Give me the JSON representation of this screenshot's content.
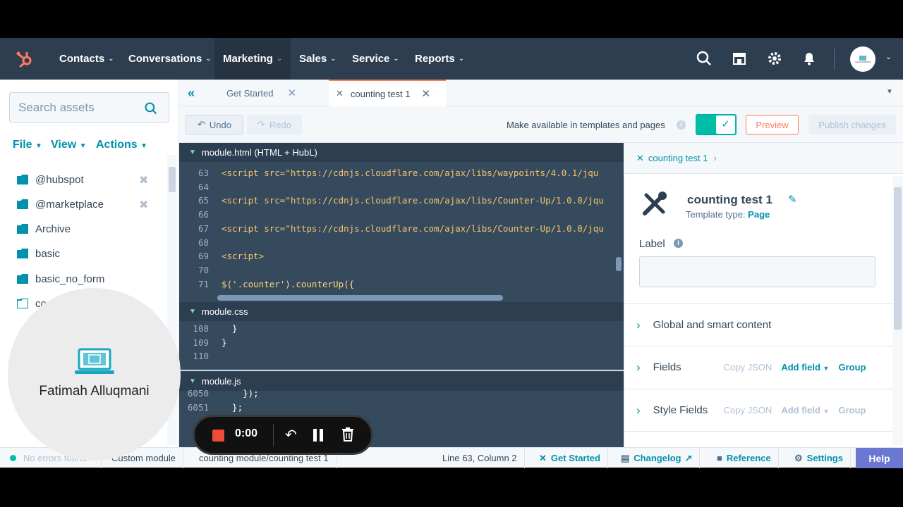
{
  "nav": {
    "items": [
      {
        "label": "Contacts"
      },
      {
        "label": "Conversations"
      },
      {
        "label": "Marketing"
      },
      {
        "label": "Sales"
      },
      {
        "label": "Service"
      },
      {
        "label": "Reports"
      }
    ],
    "avatar_text": "CHILD ANIMATE"
  },
  "sidebar": {
    "search_placeholder": "Search assets",
    "menus": [
      "File",
      "View",
      "Actions"
    ],
    "folders": [
      "@hubspot",
      "@marketplace",
      "Archive",
      "basic",
      "basic_no_form",
      "co"
    ]
  },
  "tabs": [
    {
      "label": "Get Started"
    },
    {
      "label": "counting test 1"
    }
  ],
  "toolbar": {
    "undo": "Undo",
    "redo": "Redo",
    "template_toggle_label": "Make available in templates and pages",
    "preview": "Preview",
    "publish": "Publish changes"
  },
  "editor": {
    "html_pane": "module.html (HTML + HubL)",
    "css_pane": "module.css",
    "js_pane": "module.js",
    "html_lines": [
      {
        "num": "63",
        "code": "<script src=\"https://cdnjs.cloudflare.com/ajax/libs/waypoints/4.0.1/jqu"
      },
      {
        "num": "64",
        "code": ""
      },
      {
        "num": "65",
        "code": "<script src=\"https://cdnjs.cloudflare.com/ajax/libs/Counter-Up/1.0.0/jqu"
      },
      {
        "num": "66",
        "code": ""
      },
      {
        "num": "67",
        "code": "<script src=\"https://cdnjs.cloudflare.com/ajax/libs/Counter-Up/1.0.0/jqu"
      },
      {
        "num": "68",
        "code": ""
      },
      {
        "num": "69",
        "code": "<script>"
      },
      {
        "num": "70",
        "code": ""
      },
      {
        "num": "71",
        "code": "$('.counter').counterUp({"
      }
    ],
    "css_lines": [
      {
        "num": "108",
        "code": "  }"
      },
      {
        "num": "109",
        "code": "}"
      },
      {
        "num": "110",
        "code": ""
      }
    ],
    "js_lines": [
      {
        "num": "6050",
        "code": "    });"
      },
      {
        "num": "6051",
        "code": "  };"
      }
    ]
  },
  "right_panel": {
    "breadcrumb": "counting test 1",
    "module_name": "counting test 1",
    "template_type_label": "Template type:",
    "template_type_value": "Page",
    "label_heading": "Label",
    "label_value": "",
    "sections": [
      {
        "title": "Global and smart content"
      },
      {
        "title": "Fields",
        "copy_json": "Copy JSON",
        "add_field": "Add field",
        "group": "Group"
      },
      {
        "title": "Style Fields",
        "copy_json": "Copy JSON",
        "add_field": "Add field",
        "group": "Group"
      }
    ]
  },
  "status_bar": {
    "errors": "No errors found",
    "type": "Custom module",
    "path": "counting module/counting test 1",
    "position": "Line 63, Column 2",
    "get_started": "Get Started",
    "changelog": "Changelog",
    "reference": "Reference",
    "settings": "Settings",
    "help": "Help"
  },
  "overlay": {
    "presenter_name": "Fatimah Alluqmani",
    "recording_time": "0:00"
  },
  "colors": {
    "nav_bg": "#2d3e50",
    "accent_teal": "#00a4bd",
    "accent_orange": "#ff7a59",
    "link": "#0091ae",
    "help_bg": "#6a78d1"
  }
}
